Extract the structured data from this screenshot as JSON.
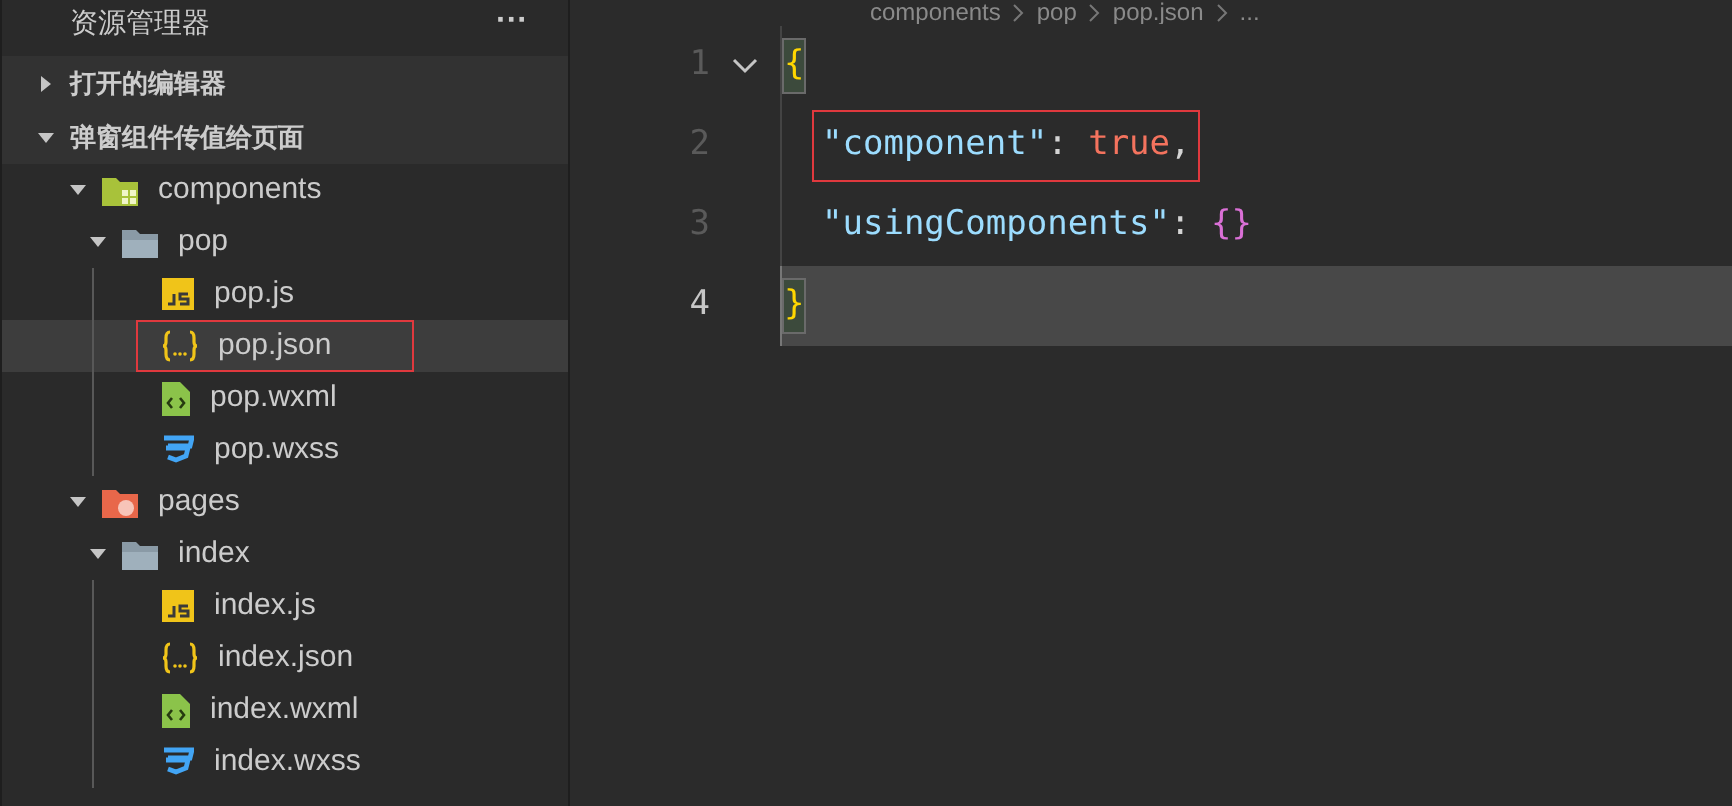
{
  "sidebar": {
    "title": "资源管理器",
    "more": "···",
    "sections": [
      {
        "label": "打开的编辑器",
        "expanded": false
      },
      {
        "label": "弹窗组件传值给页面",
        "expanded": true
      }
    ],
    "tree": [
      {
        "name": "components",
        "kind": "folder-components",
        "expanded": true,
        "selected": false,
        "annotated": false,
        "children": [
          {
            "name": "pop",
            "kind": "folder",
            "expanded": true,
            "selected": false,
            "annotated": false,
            "children": [
              {
                "name": "pop.js",
                "kind": "js",
                "selected": false,
                "annotated": false
              },
              {
                "name": "pop.json",
                "kind": "json",
                "selected": true,
                "annotated": true
              },
              {
                "name": "pop.wxml",
                "kind": "wxml",
                "selected": false,
                "annotated": false
              },
              {
                "name": "pop.wxss",
                "kind": "wxss",
                "selected": false,
                "annotated": false
              }
            ]
          }
        ]
      },
      {
        "name": "pages",
        "kind": "folder-pages",
        "expanded": true,
        "selected": false,
        "annotated": false,
        "children": [
          {
            "name": "index",
            "kind": "folder",
            "expanded": true,
            "selected": false,
            "annotated": false,
            "children": [
              {
                "name": "index.js",
                "kind": "js",
                "selected": false,
                "annotated": false
              },
              {
                "name": "index.json",
                "kind": "json",
                "selected": false,
                "annotated": false
              },
              {
                "name": "index.wxml",
                "kind": "wxml",
                "selected": false,
                "annotated": false
              },
              {
                "name": "index.wxss",
                "kind": "wxss",
                "selected": false,
                "annotated": false
              }
            ]
          }
        ]
      }
    ]
  },
  "breadcrumb": [
    "components",
    "pop",
    "pop.json",
    "..."
  ],
  "editor": {
    "lines": [
      {
        "number": "1",
        "current": false,
        "annotated": false,
        "foldable": true,
        "tokens": [
          {
            "text": "{",
            "kind": "brace",
            "bracket_match": true
          }
        ]
      },
      {
        "number": "2",
        "current": false,
        "annotated": true,
        "foldable": false,
        "tokens": [
          {
            "text": "\"component\"",
            "kind": "key",
            "bracket_match": false
          },
          {
            "text": ": ",
            "kind": "punct",
            "bracket_match": false
          },
          {
            "text": "true",
            "kind": "bool",
            "bracket_match": false
          },
          {
            "text": ",",
            "kind": "punct",
            "bracket_match": false
          }
        ]
      },
      {
        "number": "3",
        "current": false,
        "annotated": false,
        "foldable": false,
        "tokens": [
          {
            "text": "\"usingComponents\"",
            "kind": "key",
            "bracket_match": false
          },
          {
            "text": ": ",
            "kind": "punct",
            "bracket_match": false
          },
          {
            "text": "{}",
            "kind": "inner-brace",
            "bracket_match": false
          }
        ]
      },
      {
        "number": "4",
        "current": true,
        "annotated": false,
        "foldable": false,
        "tokens": [
          {
            "text": "}",
            "kind": "brace",
            "bracket_match": true
          }
        ]
      }
    ]
  }
}
